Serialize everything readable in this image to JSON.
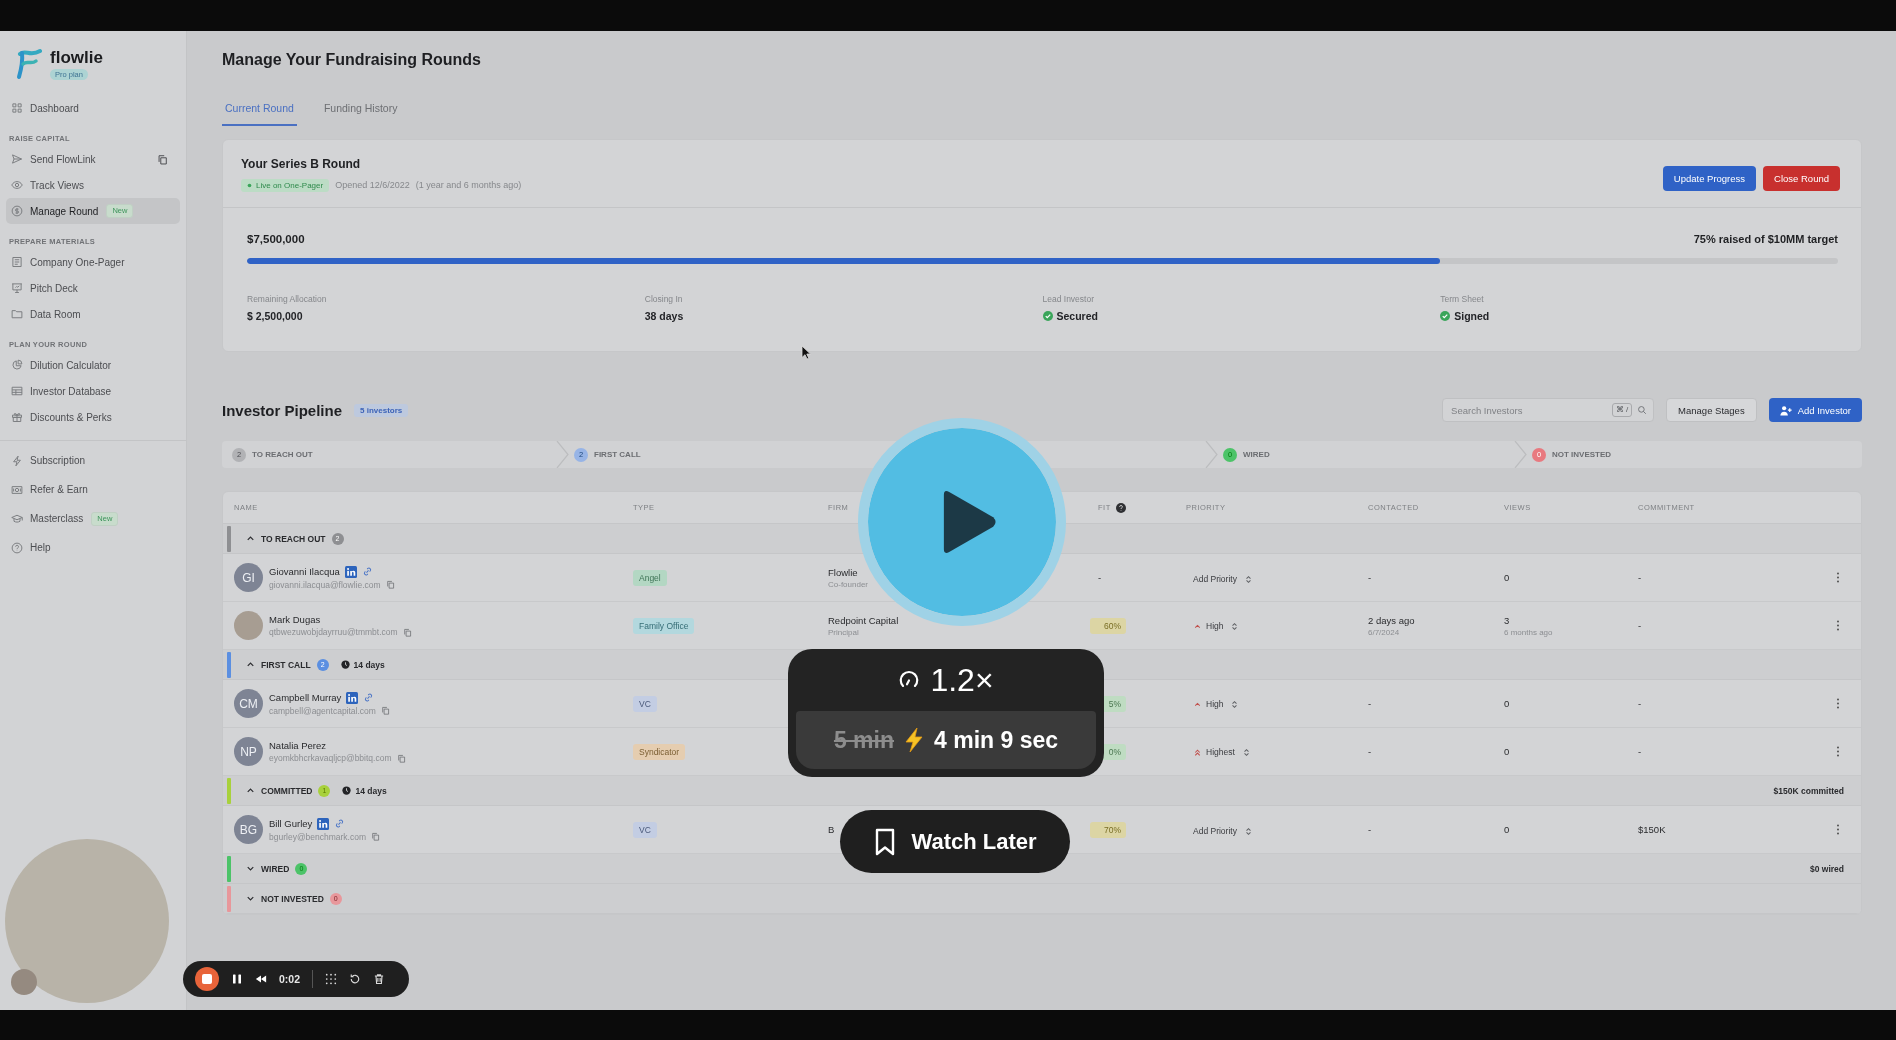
{
  "app": {
    "sidebar": {
      "logo": "flowlie",
      "plan": "Pro plan",
      "sections": [
        {
          "items": [
            {
              "label": "Dashboard",
              "selected": false,
              "copyable": false
            }
          ]
        },
        {
          "heading": "RAISE CAPITAL",
          "items": [
            {
              "label": "Send FlowLink",
              "selected": false,
              "copyable": true
            },
            {
              "label": "Track Views",
              "selected": false,
              "copyable": false
            },
            {
              "label": "Manage Round",
              "selected": true,
              "copyable": false,
              "badge": "New"
            }
          ]
        },
        {
          "heading": "PREPARE MATERIALS",
          "items": [
            {
              "label": "Company One-Pager",
              "selected": false,
              "copyable": false
            },
            {
              "label": "Pitch Deck",
              "selected": false,
              "copyable": false
            },
            {
              "label": "Data Room",
              "selected": false,
              "copyable": false
            }
          ]
        },
        {
          "heading": "PLAN YOUR ROUND",
          "items": [
            {
              "label": "Dilution Calculator",
              "selected": false,
              "copyable": false
            },
            {
              "label": "Investor Database",
              "selected": false,
              "copyable": false
            },
            {
              "label": "Discounts & Perks",
              "selected": false,
              "copyable": false
            }
          ]
        }
      ],
      "bottom_items": [
        {
          "label": "Subscription",
          "selected": false,
          "copyable": false
        },
        {
          "label": "Refer & Earn",
          "selected": false,
          "copyable": false
        },
        {
          "label": "Masterclass",
          "selected": false,
          "copyable": false,
          "badge": "New"
        },
        {
          "label": "Help",
          "selected": false,
          "copyable": false
        }
      ]
    },
    "page": {
      "title": "Manage Your Fundraising Rounds",
      "tabs": [
        {
          "label": "Current Round",
          "selected": true
        },
        {
          "label": "Funding History",
          "selected": false
        }
      ]
    },
    "round": {
      "title": "Your Series B Round",
      "status": "Live on One-Pager",
      "opened": "Opened 12/6/2022",
      "opened_ago": "(1 year and 6 months ago)",
      "buttons": [
        {
          "label": "Update Progress",
          "kind": "primary"
        },
        {
          "label": "Close Round",
          "kind": "danger"
        }
      ],
      "raised": "$7,500,000",
      "target": "75% raised of $10MM target",
      "level": 0.75,
      "stats": [
        {
          "label": "Remaining Allocation",
          "value": "$ 2,500,000",
          "confirmed": false
        },
        {
          "label": "Closing In",
          "value": "38 days",
          "confirmed": false
        },
        {
          "label": "Lead Investor",
          "value": "Secured",
          "confirmed": true
        },
        {
          "label": "Term Sheet",
          "value": "Signed",
          "confirmed": true
        }
      ]
    },
    "pipeline": {
      "title": "Investor Pipeline",
      "count": "5 investors",
      "search": {
        "placeholder": "Search Investors",
        "shortcut": "⌘ /"
      },
      "buttons": [
        {
          "label": "Manage Stages",
          "kind": "secondary"
        },
        {
          "label": "Add Investor",
          "kind": "add"
        }
      ],
      "stages": [
        {
          "count": "2",
          "label": "TO REACH OUT",
          "color": "#b1b2b5"
        },
        {
          "count": "2",
          "label": "FIRST CALL",
          "color": "#97b4e6"
        },
        {
          "count": "0",
          "label": "WIRED",
          "color": "#4cc368"
        },
        {
          "count": "0",
          "label": "NOT INVESTED",
          "color": "#e8797f"
        }
      ],
      "columns": [
        {
          "label": "NAME",
          "help": false
        },
        {
          "label": "TYPE",
          "help": false
        },
        {
          "label": "FIRM",
          "help": false
        },
        {
          "label": "FIT",
          "help": true
        },
        {
          "label": "PRIORITY",
          "help": false
        },
        {
          "label": "CONTACTED",
          "help": false
        },
        {
          "label": "VIEWS",
          "help": false
        },
        {
          "label": "COMMITMENT",
          "help": false
        }
      ],
      "groups": [
        {
          "label": "TO REACH OUT",
          "count": "2",
          "color": "#8e8f92",
          "expanded": true,
          "rows": [
            {
              "avatar": {
                "kind": "initials",
                "initials": "GI"
              },
              "name": "Giovanni Ilacqua",
              "linkedin": true,
              "link": true,
              "email": "giovanni.ilacqua@flowlie.com",
              "type": {
                "label": "Angel",
                "color": "#b3d7c3"
              },
              "firm": "Flowlie",
              "role": "Co-founder",
              "fit": {
                "text": "-"
              },
              "priority": {
                "label": "Add Priority",
                "kind": "none"
              },
              "contacted": {
                "text": "-"
              },
              "views": {
                "text": "0"
              },
              "commitment": "-"
            },
            {
              "avatar": {
                "kind": "photo"
              },
              "name": "Mark Dugas",
              "linkedin": false,
              "link": false,
              "email": "qtbwezuwobjdayrruu@tmmbt.com",
              "type": {
                "label": "Family Office",
                "color": "#b3d8de"
              },
              "firm": "Redpoint Capital",
              "role": "Principal",
              "fit": {
                "text": "60%",
                "color": "#dcd5a4"
              },
              "priority": {
                "label": "High",
                "kind": "high"
              },
              "contacted": {
                "text": "2 days ago",
                "note": "6/7/2024"
              },
              "views": {
                "text": "3",
                "note": "6 months ago"
              },
              "commitment": "-"
            }
          ]
        },
        {
          "label": "FIRST CALL",
          "count": "2",
          "color": "#5b8fe1",
          "expanded": true,
          "duration": "14 days",
          "rows": [
            {
              "avatar": {
                "kind": "initials",
                "initials": "CM"
              },
              "name": "Campbell Murray",
              "linkedin": true,
              "link": true,
              "email": "campbell@agentcapital.com",
              "type": {
                "label": "VC",
                "color": "#c3cde3"
              },
              "fit": {
                "text": "5%",
                "color": "#bfdcc2"
              },
              "priority": {
                "label": "High",
                "kind": "high"
              },
              "contacted": {
                "text": "-"
              },
              "views": {
                "text": "0"
              },
              "commitment": "-"
            },
            {
              "avatar": {
                "kind": "initials",
                "initials": "NP"
              },
              "name": "Natalia Perez",
              "linkedin": false,
              "link": false,
              "email": "eyomkbhcrkavaqljcp@bbitq.com",
              "type": {
                "label": "Syndicator",
                "color": "#e5cdb0"
              },
              "fit": {
                "text": "0%",
                "color": "#bfdcc2"
              },
              "priority": {
                "label": "Highest",
                "kind": "highest"
              },
              "contacted": {
                "text": "-"
              },
              "views": {
                "text": "0"
              },
              "commitment": "-"
            }
          ]
        },
        {
          "label": "COMMITTED",
          "count": "1",
          "color": "#a8d13c",
          "expanded": true,
          "duration": "14 days",
          "total": "$150K committed",
          "rows": [
            {
              "avatar": {
                "kind": "initials",
                "initials": "BG"
              },
              "name": "Bill Gurley",
              "linkedin": true,
              "link": true,
              "email": "bgurley@benchmark.com",
              "type": {
                "label": "VC",
                "color": "#c3cde3"
              },
              "firm": "B",
              "fit": {
                "text": "70%",
                "color": "#dcd5a4"
              },
              "priority": {
                "label": "Add Priority",
                "kind": "none"
              },
              "contacted": {
                "text": "-"
              },
              "views": {
                "text": "0"
              },
              "commitment": "$150K"
            }
          ]
        },
        {
          "label": "WIRED",
          "count": "0",
          "color": "#4cc368",
          "expanded": false,
          "total": "$0 wired"
        },
        {
          "label": "NOT INVESTED",
          "count": "0",
          "color": "#e8979b",
          "expanded": false
        }
      ]
    }
  },
  "player": {
    "speed": "1.2×",
    "original_duration": "5 min",
    "fast_duration": "4 min 9 sec",
    "watch_later": "Watch Later"
  },
  "recorder": {
    "time": "0:02"
  }
}
